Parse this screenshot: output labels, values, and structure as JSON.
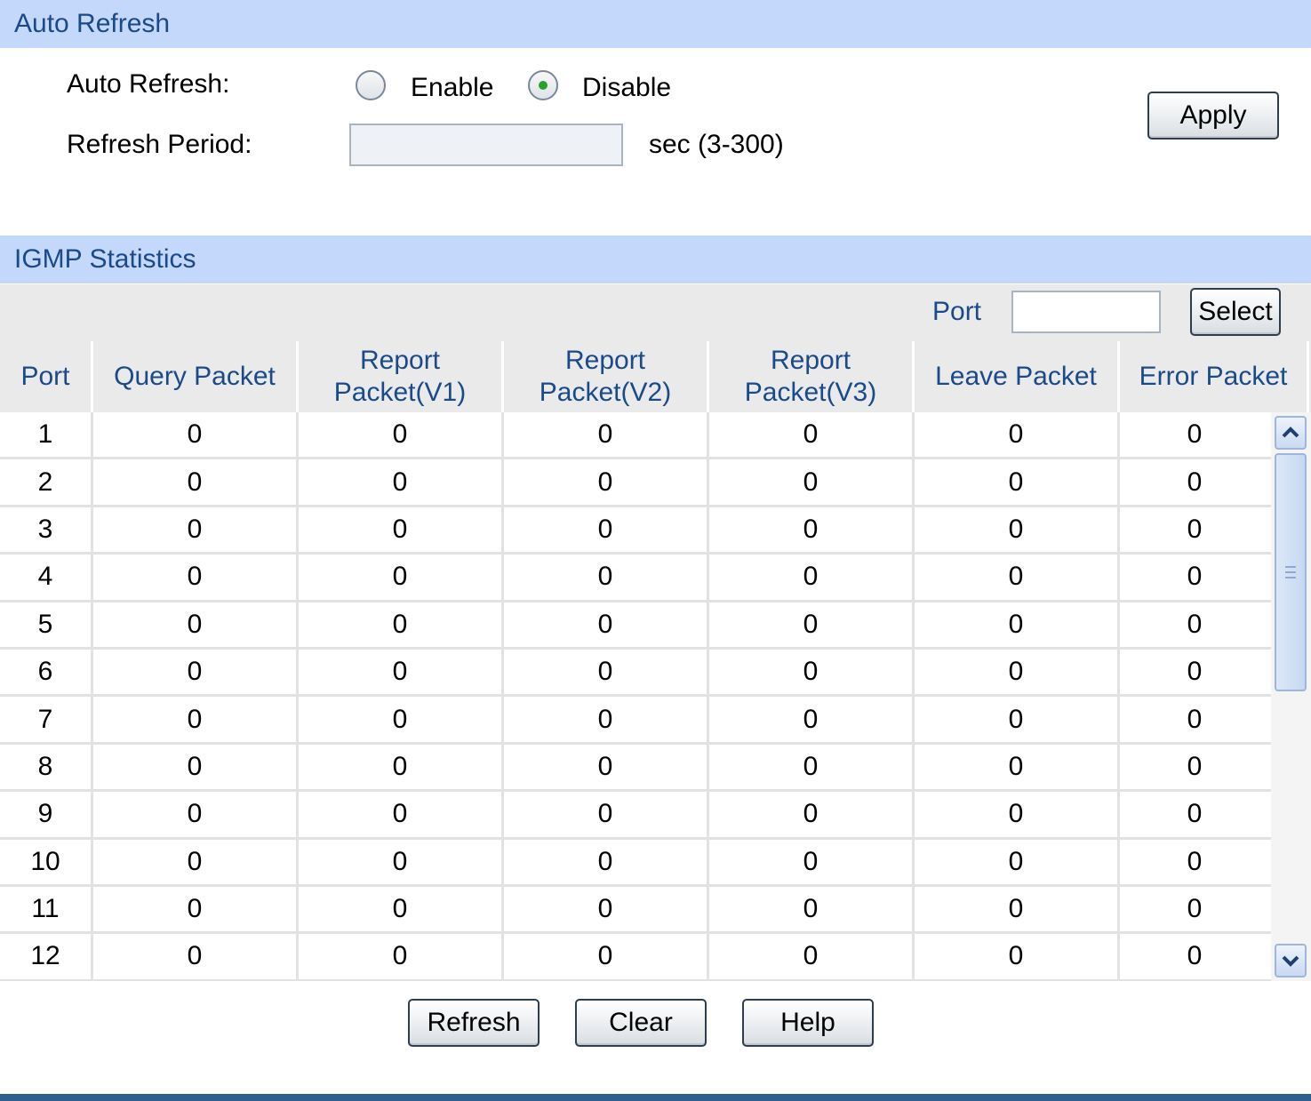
{
  "auto_refresh": {
    "section_title": "Auto Refresh",
    "auto_refresh_label": "Auto Refresh:",
    "enable_label": "Enable",
    "disable_label": "Disable",
    "selected": "Disable",
    "refresh_period_label": "Refresh Period:",
    "refresh_period_value": "",
    "unit_label": "sec (3-300)",
    "apply_label": "Apply"
  },
  "igmp": {
    "section_title": "IGMP Statistics",
    "port_filter_label": "Port",
    "port_filter_value": "",
    "select_label": "Select",
    "columns": [
      "Port",
      "Query Packet",
      "Report Packet(V1)",
      "Report Packet(V2)",
      "Report Packet(V3)",
      "Leave Packet",
      "Error Packet"
    ],
    "header_lines": [
      [
        "Port"
      ],
      [
        "Query Packet"
      ],
      [
        "Report",
        "Packet(V1)"
      ],
      [
        "Report",
        "Packet(V2)"
      ],
      [
        "Report",
        "Packet(V3)"
      ],
      [
        "Leave Packet"
      ],
      [
        "Error Packet"
      ]
    ],
    "rows": [
      [
        "1",
        "0",
        "0",
        "0",
        "0",
        "0",
        "0"
      ],
      [
        "2",
        "0",
        "0",
        "0",
        "0",
        "0",
        "0"
      ],
      [
        "3",
        "0",
        "0",
        "0",
        "0",
        "0",
        "0"
      ],
      [
        "4",
        "0",
        "0",
        "0",
        "0",
        "0",
        "0"
      ],
      [
        "5",
        "0",
        "0",
        "0",
        "0",
        "0",
        "0"
      ],
      [
        "6",
        "0",
        "0",
        "0",
        "0",
        "0",
        "0"
      ],
      [
        "7",
        "0",
        "0",
        "0",
        "0",
        "0",
        "0"
      ],
      [
        "8",
        "0",
        "0",
        "0",
        "0",
        "0",
        "0"
      ],
      [
        "9",
        "0",
        "0",
        "0",
        "0",
        "0",
        "0"
      ],
      [
        "10",
        "0",
        "0",
        "0",
        "0",
        "0",
        "0"
      ],
      [
        "11",
        "0",
        "0",
        "0",
        "0",
        "0",
        "0"
      ],
      [
        "12",
        "0",
        "0",
        "0",
        "0",
        "0",
        "0"
      ]
    ]
  },
  "actions": {
    "refresh_label": "Refresh",
    "clear_label": "Clear",
    "help_label": "Help"
  },
  "colors": {
    "section_header_bg": "#c4d8fb",
    "section_header_text": "#1a4a8a",
    "radio_checked": "#2ca02c"
  }
}
